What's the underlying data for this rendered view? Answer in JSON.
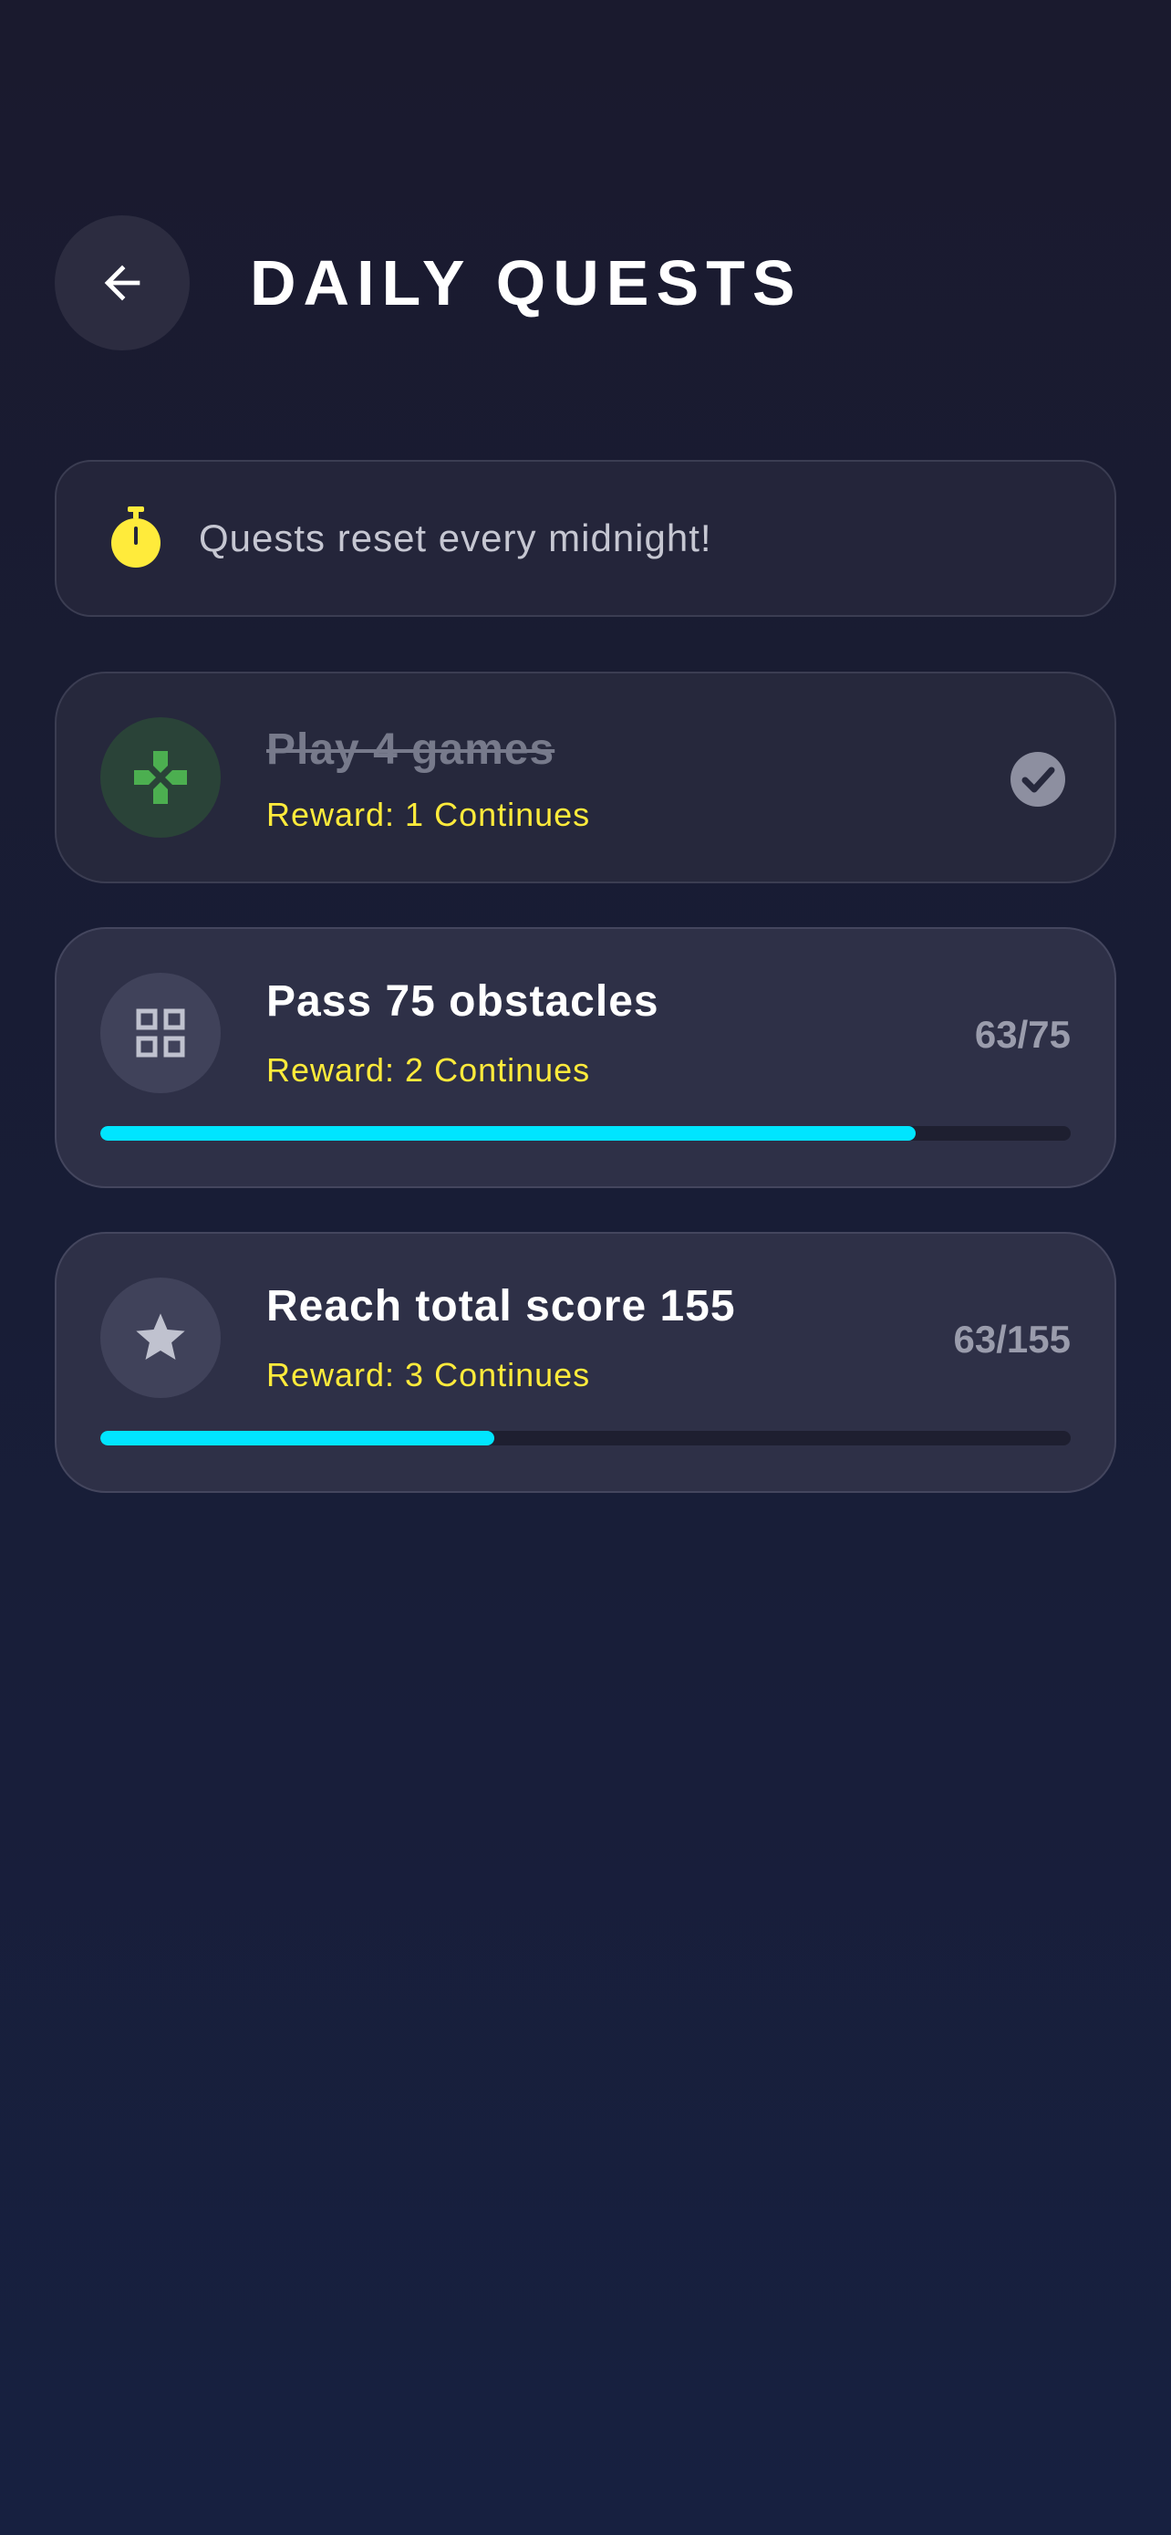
{
  "header": {
    "title": "DAILY QUESTS",
    "back_icon": "arrow-left-icon"
  },
  "banner": {
    "icon": "stopwatch-icon",
    "text": "Quests reset every midnight!"
  },
  "quests": [
    {
      "title": "Play 4 games",
      "reward": "Reward: 1 Continues",
      "icon": "gamepad-icon",
      "completed": true,
      "status_icon": "check-circle-icon"
    },
    {
      "title": "Pass 75 obstacles",
      "reward": "Reward: 2 Continues",
      "icon": "grid-icon",
      "completed": false,
      "progress_text": "63/75",
      "current": 63,
      "target": 75
    },
    {
      "title": "Reach total score 155",
      "reward": "Reward: 3 Continues",
      "icon": "star-icon",
      "completed": false,
      "progress_text": "63/155",
      "current": 63,
      "target": 155
    }
  ],
  "colors": {
    "background": "#181d36",
    "card": "#2e3047",
    "reward": "#ffeb3b",
    "progress": "#00e5ff",
    "complete_icon": "#4caf50"
  }
}
